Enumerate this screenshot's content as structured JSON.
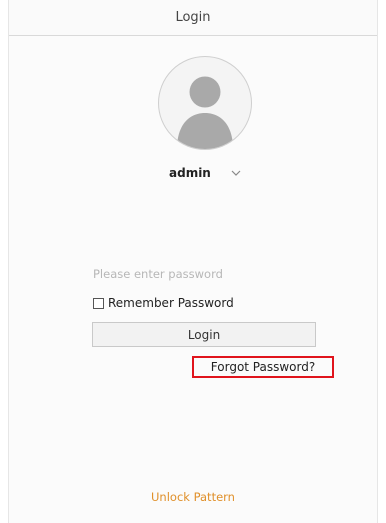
{
  "window": {
    "title": "Login"
  },
  "user": {
    "name": "admin",
    "avatar_icon": "user-silhouette-icon",
    "dropdown_icon": "chevron-down-icon"
  },
  "password": {
    "placeholder": "Please enter password",
    "value": ""
  },
  "remember": {
    "label": "Remember Password",
    "checked": false
  },
  "buttons": {
    "login_label": "Login",
    "forgot_label": "Forgot Password?",
    "unlock_label": "Unlock Pattern"
  },
  "colors": {
    "highlight_border": "#e0141c",
    "unlock_link": "#e0902a",
    "avatar_silhouette": "#a9a9a9"
  }
}
